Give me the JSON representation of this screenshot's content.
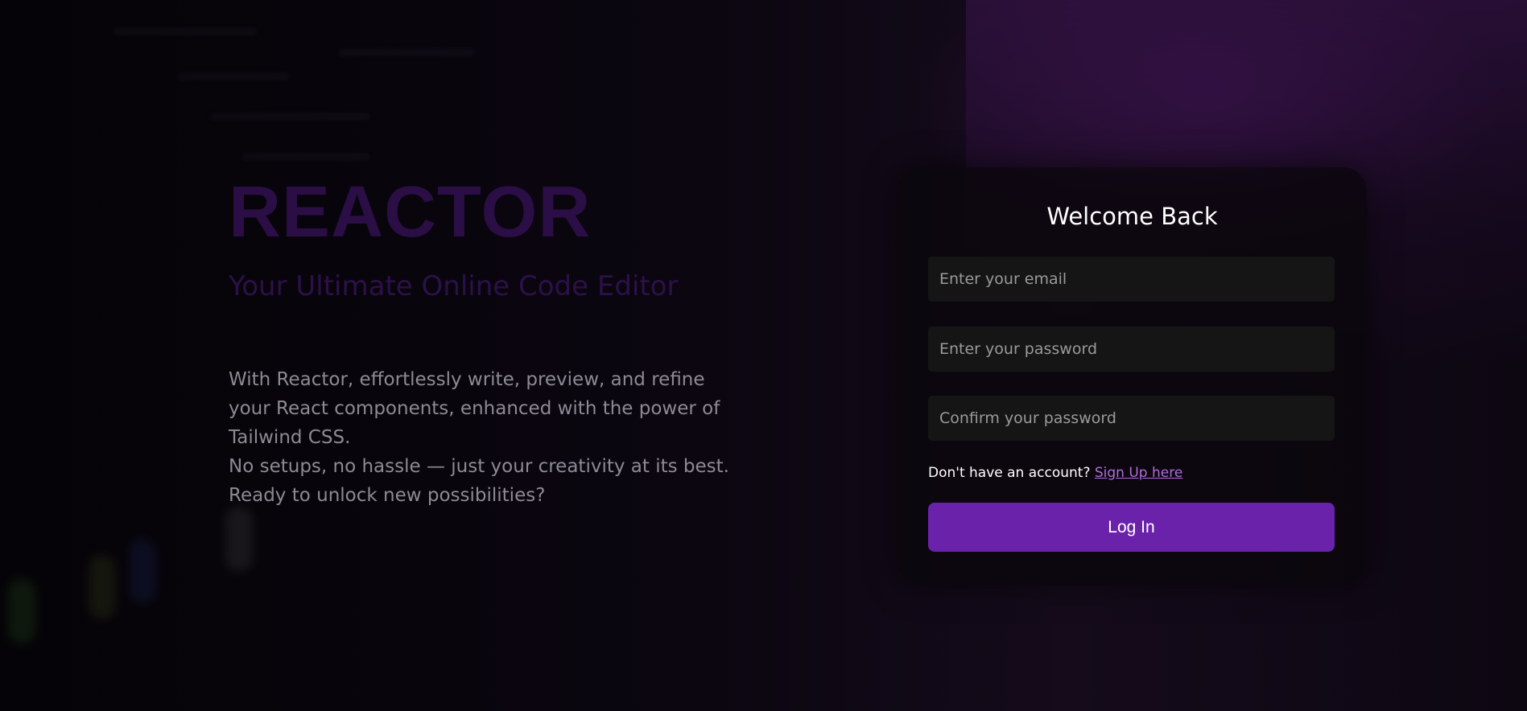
{
  "hero": {
    "title": "REACTOR",
    "subtitle": "Your Ultimate Online Code Editor",
    "description_lines": [
      "With Reactor, effortlessly write, preview, and refine your React components, enhanced with the power of Tailwind CSS.",
      "No setups, no hassle — just your creativity at its best. Ready to unlock new possibilities?"
    ]
  },
  "login": {
    "title": "Welcome Back",
    "email_placeholder": "Enter your email",
    "password_placeholder": "Enter your password",
    "confirm_placeholder": "Confirm your password",
    "signup_prompt": "Don't have an account?",
    "signup_link": "Sign Up here",
    "login_button": "Log In"
  },
  "colors": {
    "accent": "#6a22ab",
    "title_purple": "#2a0e45",
    "link": "#b06ce0"
  }
}
